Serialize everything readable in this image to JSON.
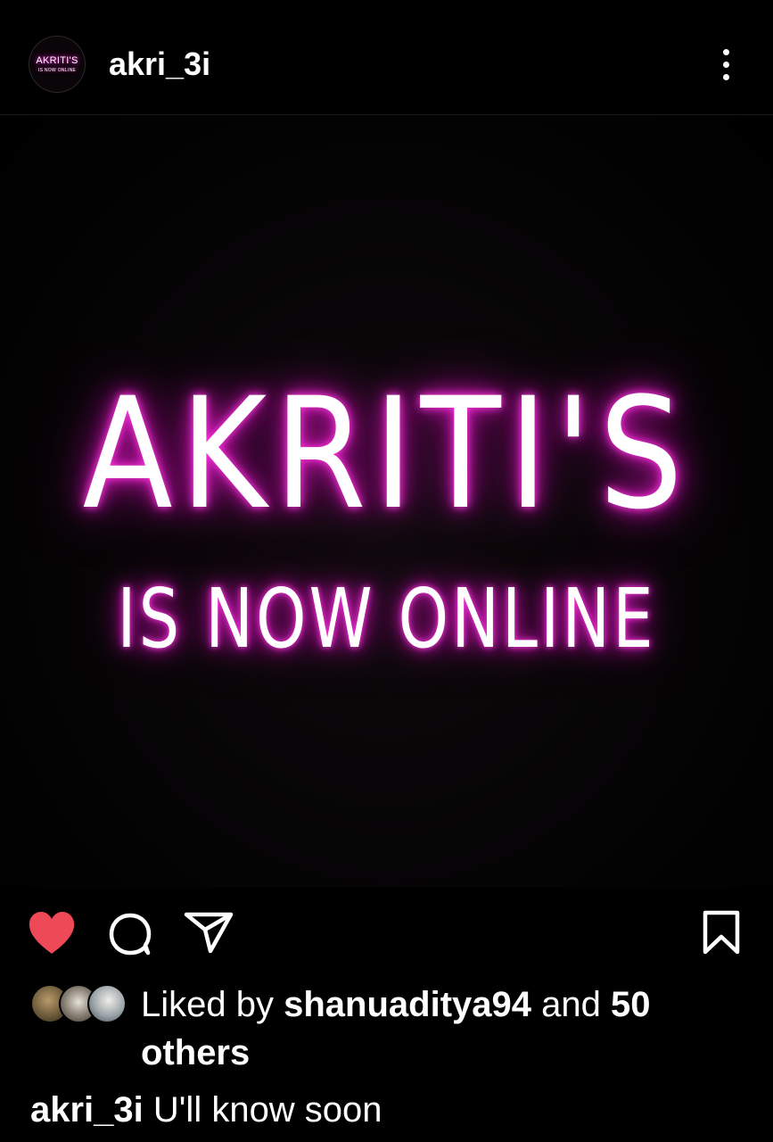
{
  "header": {
    "avatar_line1": "AKRITI'S",
    "avatar_line2": "IS NOW ONLINE",
    "username": "akri_3i"
  },
  "post_image": {
    "line1": "AKRITI'S",
    "line2": "IS NOW ONLINE",
    "neon_color": "#ff2bd6"
  },
  "actions": {
    "like_icon": "heart-filled-icon",
    "like_color": "#ed4956",
    "comment_icon": "comment-icon",
    "share_icon": "send-icon",
    "save_icon": "bookmark-icon"
  },
  "likes": {
    "prefix": "Liked by",
    "user": "shanuaditya94",
    "middle": "and",
    "count_text": "50 others"
  },
  "caption": {
    "username": "akri_3i",
    "text": "U'll know soon"
  }
}
